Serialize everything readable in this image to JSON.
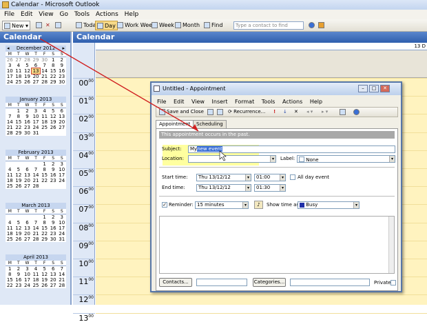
{
  "window": {
    "title": "Calendar - Microsoft Outlook"
  },
  "menu": [
    "File",
    "Edit",
    "View",
    "Go",
    "Tools",
    "Actions",
    "Help"
  ],
  "toolbar": {
    "new": "New",
    "today": "Today",
    "day": "Day",
    "work_week": "Work Week",
    "week": "Week",
    "month": "Month",
    "find": "Find",
    "search_placeholder": "Type a contact to find"
  },
  "left": {
    "title": "Calendar",
    "months": [
      {
        "name": "December 2012",
        "days_header": [
          "M",
          "T",
          "W",
          "T",
          "F",
          "S",
          "S"
        ],
        "rows": [
          [
            "26",
            "27",
            "28",
            "29",
            "30",
            "1",
            "2"
          ],
          [
            "3",
            "4",
            "5",
            "6",
            "7",
            "8",
            "9"
          ],
          [
            "10",
            "11",
            "12",
            "13",
            "14",
            "15",
            "16"
          ],
          [
            "17",
            "18",
            "19",
            "20",
            "21",
            "22",
            "23"
          ],
          [
            "24",
            "25",
            "26",
            "27",
            "28",
            "29",
            "30"
          ]
        ],
        "today": "13"
      },
      {
        "name": "January 2013",
        "days_header": [
          "M",
          "T",
          "W",
          "T",
          "F",
          "S",
          "S"
        ],
        "rows": [
          [
            "",
            "1",
            "2",
            "3",
            "4",
            "5",
            "6"
          ],
          [
            "7",
            "8",
            "9",
            "10",
            "11",
            "12",
            "13"
          ],
          [
            "14",
            "15",
            "16",
            "17",
            "18",
            "19",
            "20"
          ],
          [
            "21",
            "22",
            "23",
            "24",
            "25",
            "26",
            "27"
          ],
          [
            "28",
            "29",
            "30",
            "31",
            "",
            "",
            ""
          ]
        ]
      },
      {
        "name": "February 2013",
        "days_header": [
          "M",
          "T",
          "W",
          "T",
          "F",
          "S",
          "S"
        ],
        "rows": [
          [
            "",
            "",
            "",
            "",
            "1",
            "2",
            "3"
          ],
          [
            "4",
            "5",
            "6",
            "7",
            "8",
            "9",
            "10"
          ],
          [
            "11",
            "12",
            "13",
            "14",
            "15",
            "16",
            "17"
          ],
          [
            "18",
            "19",
            "20",
            "21",
            "22",
            "23",
            "24"
          ],
          [
            "25",
            "26",
            "27",
            "28",
            "",
            "",
            ""
          ]
        ]
      },
      {
        "name": "March 2013",
        "days_header": [
          "M",
          "T",
          "W",
          "T",
          "F",
          "S",
          "S"
        ],
        "rows": [
          [
            "",
            "",
            "",
            "",
            "1",
            "2",
            "3"
          ],
          [
            "4",
            "5",
            "6",
            "7",
            "8",
            "9",
            "10"
          ],
          [
            "11",
            "12",
            "13",
            "14",
            "15",
            "16",
            "17"
          ],
          [
            "18",
            "19",
            "20",
            "21",
            "22",
            "23",
            "24"
          ],
          [
            "25",
            "26",
            "27",
            "28",
            "29",
            "30",
            "31"
          ]
        ]
      },
      {
        "name": "April 2013",
        "days_header": [
          "M",
          "T",
          "W",
          "T",
          "F",
          "S",
          "S"
        ],
        "rows": [
          [
            "1",
            "2",
            "3",
            "4",
            "5",
            "6",
            "7"
          ],
          [
            "8",
            "9",
            "10",
            "11",
            "12",
            "13",
            "14"
          ],
          [
            "15",
            "16",
            "17",
            "18",
            "19",
            "20",
            "21"
          ],
          [
            "22",
            "23",
            "24",
            "25",
            "26",
            "27",
            "28"
          ]
        ]
      }
    ]
  },
  "right": {
    "title": "Calendar",
    "day_header": "13 D",
    "hours": [
      "00",
      "01",
      "02",
      "03",
      "04",
      "05",
      "06",
      "07",
      "08",
      "09",
      "10",
      "11",
      "12",
      "13"
    ],
    "minutes": "00"
  },
  "dialog": {
    "title": "Untitled - Appointment",
    "menu": [
      "File",
      "Edit",
      "View",
      "Insert",
      "Format",
      "Tools",
      "Actions",
      "Help"
    ],
    "save_close": "Save and Close",
    "recurrence": "Recurrence...",
    "tabs": [
      "Appointment",
      "Scheduling"
    ],
    "banner": "This appointment occurs in the past.",
    "subject_label": "Subject:",
    "subject_prefix": "My",
    "subject_selected": "new event",
    "location_label": "Location:",
    "label_label": "Label:",
    "label_value": "None",
    "start_label": "Start time:",
    "start_date": "Thu 13/12/12",
    "start_time": "01:00",
    "end_label": "End time:",
    "end_date": "Thu 13/12/12",
    "end_time": "01:30",
    "all_day": "All day event",
    "reminder_label": "Reminder:",
    "reminder_value": "15 minutes",
    "show_time_label": "Show time as:",
    "show_time_value": "Busy",
    "contacts": "Contacts...",
    "categories": "Categories...",
    "private": "Private"
  },
  "colors": {
    "header_blue": "#2f5fae",
    "day_yellow": "#fff3bf",
    "highlight": "#ffff50",
    "arrow": "#d02020"
  }
}
